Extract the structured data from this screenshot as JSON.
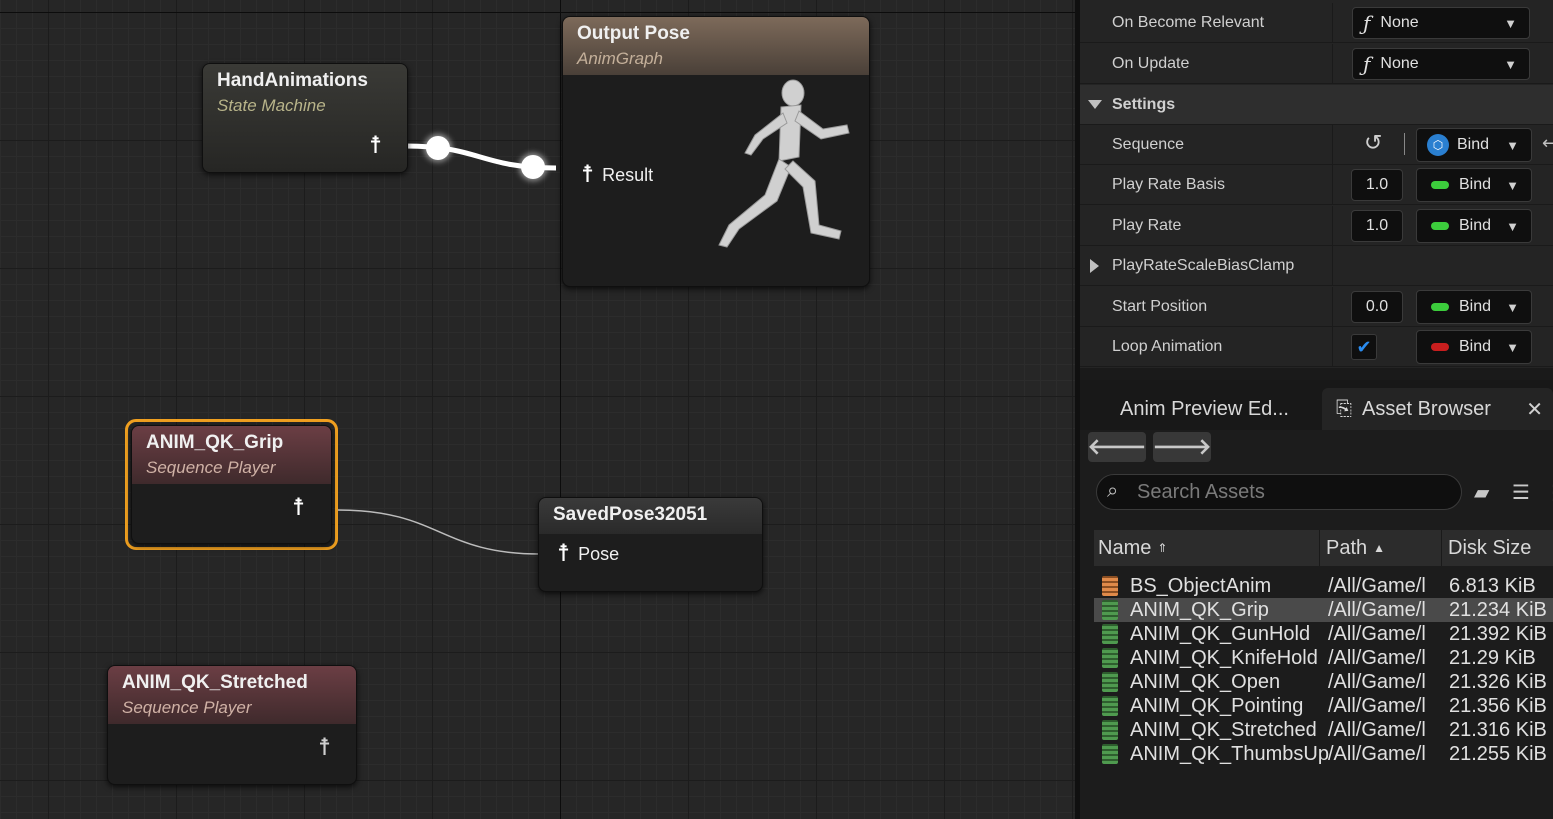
{
  "graph": {
    "nodes": {
      "hand_animations": {
        "title": "HandAnimations",
        "subtitle": "State Machine"
      },
      "output_pose": {
        "title": "Output Pose",
        "subtitle": "AnimGraph",
        "pin": "Result"
      },
      "grip": {
        "title": "ANIM_QK_Grip",
        "subtitle": "Sequence Player"
      },
      "saved_pose": {
        "title": "SavedPose32051",
        "pin": "Pose"
      },
      "stretched": {
        "title": "ANIM_QK_Stretched",
        "subtitle": "Sequence Player"
      }
    }
  },
  "details": {
    "rows": {
      "on_become_relevant": {
        "label": "On Become Relevant",
        "value": "None"
      },
      "on_update": {
        "label": "On Update",
        "value": "None"
      },
      "settings": {
        "label": "Settings"
      },
      "sequence": {
        "label": "Sequence",
        "bind": "Bind"
      },
      "play_rate_basis": {
        "label": "Play Rate Basis",
        "value": "1.0",
        "bind": "Bind"
      },
      "play_rate": {
        "label": "Play Rate",
        "value": "1.0",
        "bind": "Bind"
      },
      "clamp": {
        "label": "PlayRateScaleBiasClamp"
      },
      "start_position": {
        "label": "Start Position",
        "value": "0.0",
        "bind": "Bind"
      },
      "loop_animation": {
        "label": "Loop Animation",
        "checked": true,
        "bind": "Bind"
      }
    },
    "colors": {
      "bind_green": "#3ccc3c",
      "bind_red": "#c81e1e",
      "selection_orange": "#f0a020",
      "check_blue": "#2a8cf0"
    }
  },
  "asset_panel": {
    "tabs": {
      "preview": "Anim Preview Ed...",
      "browser": "Asset Browser"
    },
    "search_placeholder": "Search Assets",
    "columns": {
      "name": "Name",
      "path": "Path",
      "size": "Disk Size"
    },
    "assets": [
      {
        "name": "BS_ObjectAnim",
        "path": "/All/Game/l",
        "size": "6.813 KiB",
        "kind": "blend"
      },
      {
        "name": "ANIM_QK_Grip",
        "path": "/All/Game/l",
        "size": "21.234 KiB",
        "kind": "anim",
        "selected": true
      },
      {
        "name": "ANIM_QK_GunHold",
        "path": "/All/Game/l",
        "size": "21.392 KiB",
        "kind": "anim"
      },
      {
        "name": "ANIM_QK_KnifeHold",
        "path": "/All/Game/l",
        "size": "21.29 KiB",
        "kind": "anim"
      },
      {
        "name": "ANIM_QK_Open",
        "path": "/All/Game/l",
        "size": "21.326 KiB",
        "kind": "anim"
      },
      {
        "name": "ANIM_QK_Pointing",
        "path": "/All/Game/l",
        "size": "21.356 KiB",
        "kind": "anim"
      },
      {
        "name": "ANIM_QK_Stretched",
        "path": "/All/Game/l",
        "size": "21.316 KiB",
        "kind": "anim"
      },
      {
        "name": "ANIM_QK_ThumbsUp",
        "path": "/All/Game/l",
        "size": "21.255 KiB",
        "kind": "anim"
      }
    ]
  }
}
